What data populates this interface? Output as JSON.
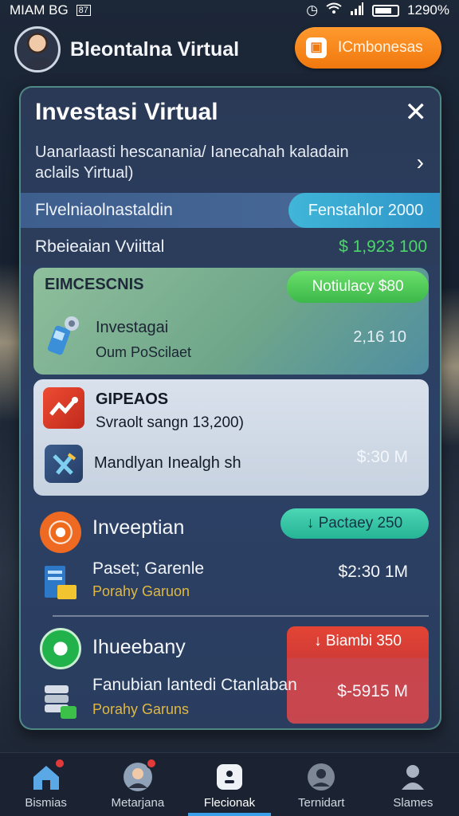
{
  "status_bar": {
    "left_text": "MIAM BG",
    "sim_label": "87",
    "battery": "1290%"
  },
  "header": {
    "title": "Bleontalna Virtual",
    "action_button": "ICmbonesas",
    "action_icon": "lock-icon"
  },
  "panel": {
    "title": "Investasi Virtual",
    "close_symbol": "✕",
    "description": "Uanarlaasti hescanania/ Ianecahah kaladain aclails Yirtual)",
    "chevron": "›",
    "band_row": {
      "label": "Flvelniaolnastaldin",
      "pill": "Fenstahlor 2000"
    },
    "virtual_row": {
      "label": "Rbeieaian Vviittal",
      "value": "$ 1,923 100"
    },
    "card1": {
      "header": "EIMCESCNIS",
      "pill": "Notiulacy $80",
      "title": "Investagai",
      "subtitle": "Oum PoScilaet",
      "value": "2,16 10",
      "icon": "usb-stick-icon"
    },
    "card2": {
      "header": "GIPEAOS",
      "subtitle": "Svraolt  sangn 13,200)",
      "line2": "Mandlyan Inealgh sh",
      "value": "$:30 M",
      "icon1": "chart-app-icon",
      "icon2": "x-logo-icon"
    },
    "item3": {
      "header": "Inveeptian",
      "pill": "Pactaey 250",
      "pill_icon": "↓",
      "title": "Paset; Garenle",
      "subtitle": "Porahy Garuon",
      "value": "$2:30 1M",
      "icon1": "target-app-icon",
      "icon2": "document-icon"
    },
    "item4": {
      "header": "Ihueebany",
      "box_label": "Biambi 350",
      "box_icon": "↓",
      "title": "Fanubian lantedi Ctanlaban",
      "subtitle": "Porahy Garuns",
      "value": "$-5915 M",
      "icon1": "chat-bubble-icon",
      "icon2": "database-icon"
    }
  },
  "bottom_nav": [
    {
      "label": "Bismias",
      "icon": "home-icon"
    },
    {
      "label": "Metarjana",
      "icon": "profile-avatar-icon"
    },
    {
      "label": "Flecionak",
      "icon": "wallet-icon"
    },
    {
      "label": "Ternidart",
      "icon": "person-icon"
    },
    {
      "label": "Slames",
      "icon": "user-icon"
    }
  ],
  "colors": {
    "accent_orange": "#f0780e",
    "green_value": "#4cd66a",
    "nav_active": "#3aa0e8"
  }
}
